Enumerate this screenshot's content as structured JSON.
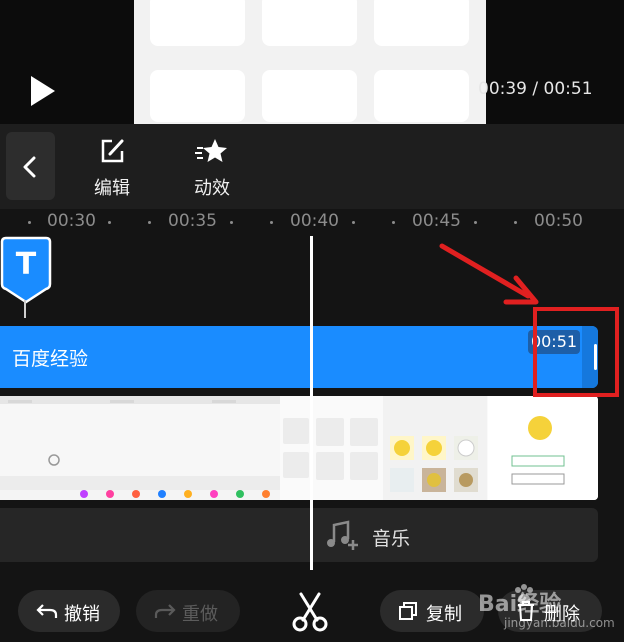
{
  "player": {
    "time_readout": "00:39 / 00:51"
  },
  "toolbar": {
    "edit_label": "编辑",
    "animation_label": "动效"
  },
  "ruler": {
    "ticks": [
      "00:30",
      "00:35",
      "00:40",
      "00:45",
      "00:50"
    ]
  },
  "text_track": {
    "marker_letter": "T",
    "clip_label": "百度经验",
    "clip_end_time": "00:51"
  },
  "music_track": {
    "label": "音乐"
  },
  "bottom_bar": {
    "undo_label": "撤销",
    "redo_label": "重做",
    "copy_label": "复制",
    "delete_label": "删除"
  },
  "watermark": {
    "text": "Bai经验",
    "url": "jingyan.baidu.com"
  },
  "colors": {
    "accent": "#1a8cff",
    "annotation_red": "#e02020",
    "background": "#141414"
  },
  "icons": [
    "play-icon",
    "back-chevron-icon",
    "edit-icon",
    "animation-star-icon",
    "text-marker-icon",
    "music-add-icon",
    "undo-icon",
    "redo-icon",
    "scissors-icon",
    "copy-icon",
    "delete-icon"
  ]
}
